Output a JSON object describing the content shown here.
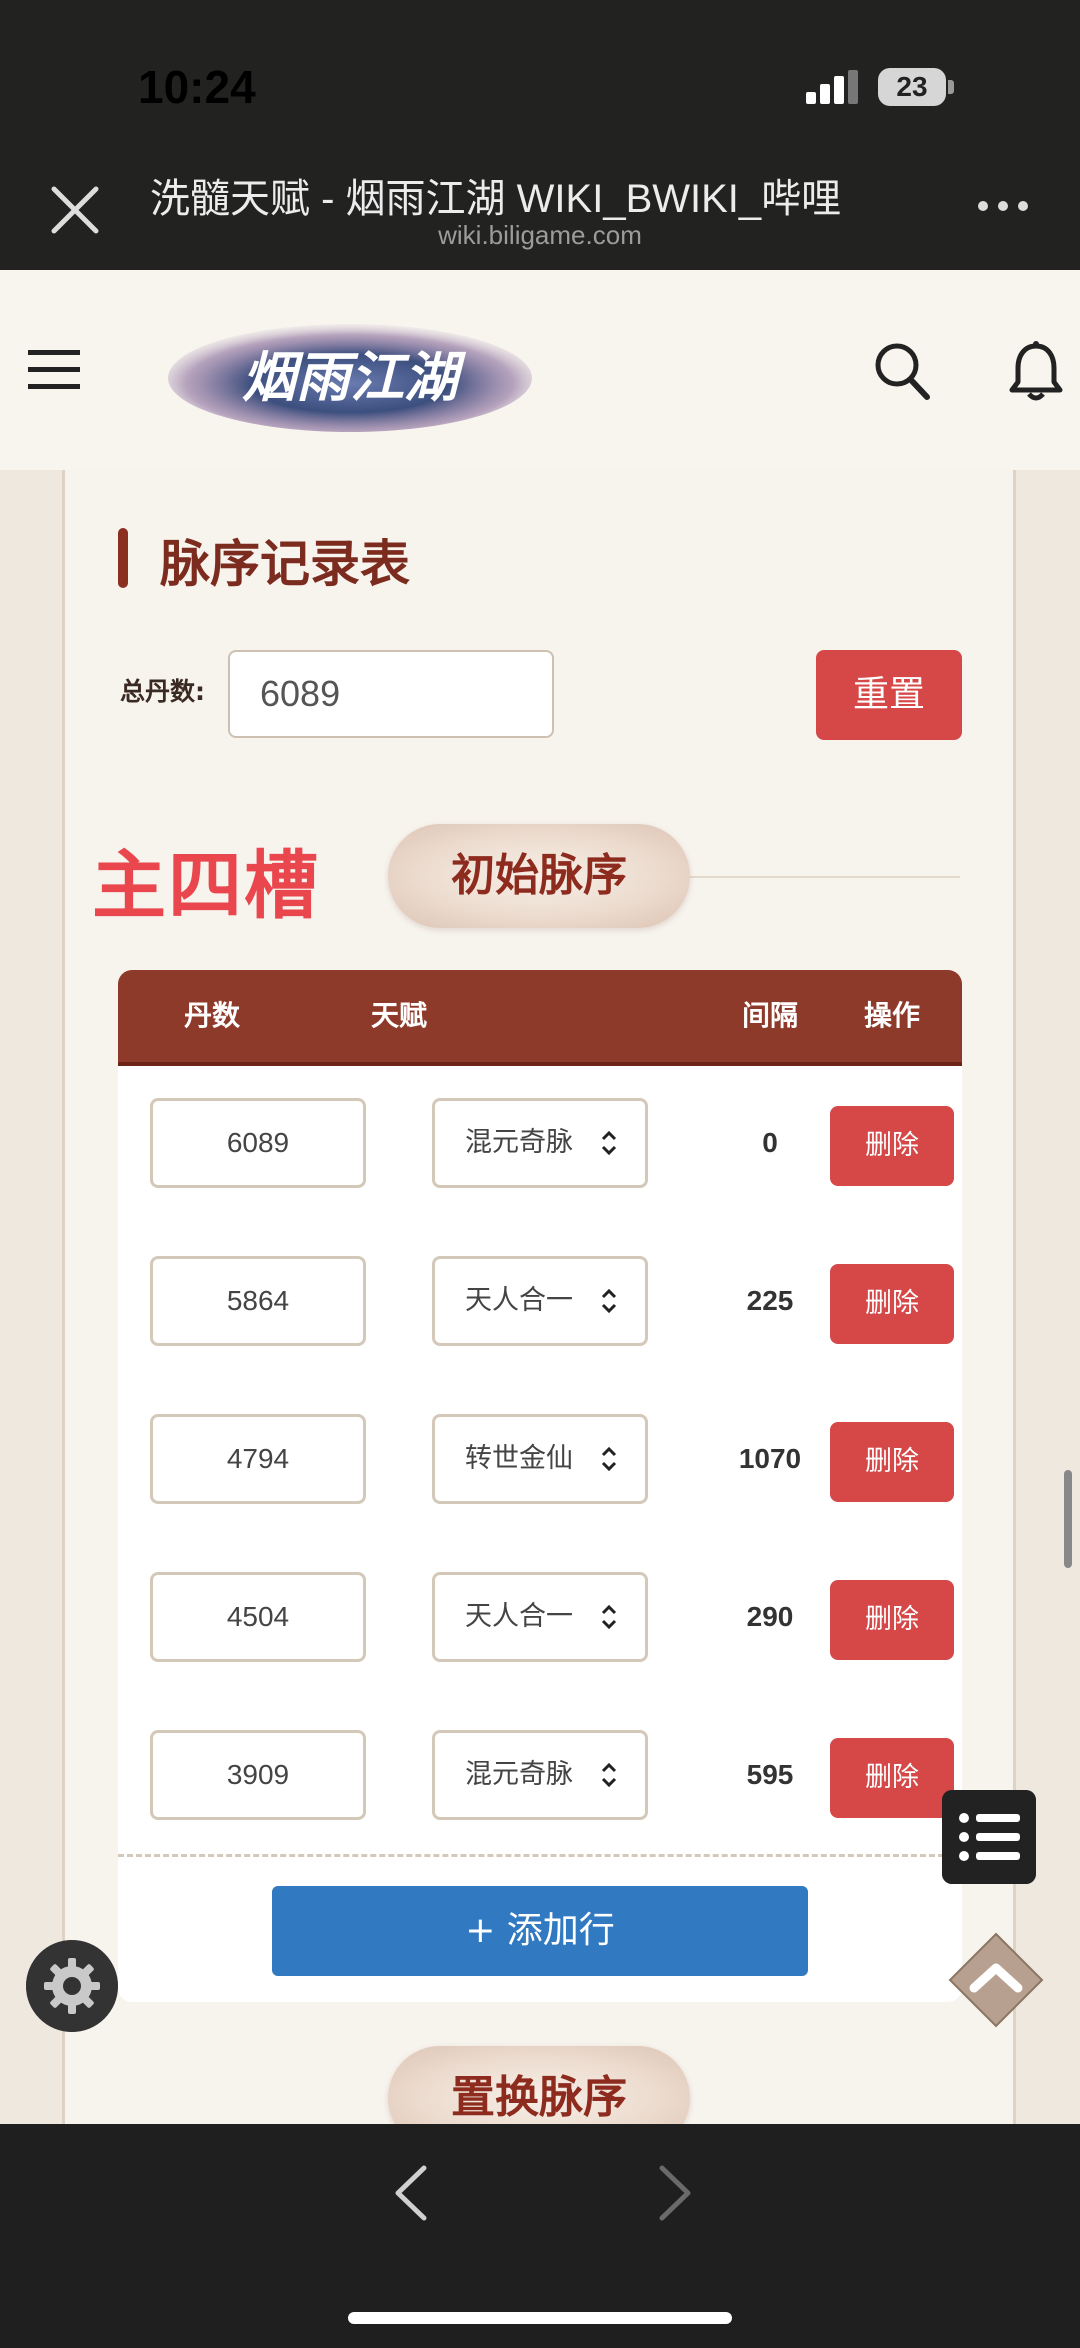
{
  "status_bar": {
    "time": "10:24",
    "battery": "23"
  },
  "browser": {
    "title": "洗髓天赋 - 烟雨江湖 WIKI_BWIKI_哔哩",
    "url": "wiki.biligame.com"
  },
  "site": {
    "logo_text": "烟雨江湖"
  },
  "section": {
    "title": "脉序记录表",
    "total_label": "总丹数:",
    "total_value": "6089",
    "reset_label": "重置"
  },
  "slot": {
    "title": "主四槽",
    "initial_label": "初始脉序",
    "swap_label": "置换脉序"
  },
  "table": {
    "headers": [
      "丹数",
      "天赋",
      "间隔",
      "操作"
    ],
    "rows": [
      {
        "dan": "6089",
        "talent": "混元奇脉",
        "gap": "0",
        "action": "删除"
      },
      {
        "dan": "5864",
        "talent": "天人合一",
        "gap": "225",
        "action": "删除"
      },
      {
        "dan": "4794",
        "talent": "转世金仙",
        "gap": "1070",
        "action": "删除"
      },
      {
        "dan": "4504",
        "talent": "天人合一",
        "gap": "290",
        "action": "删除"
      },
      {
        "dan": "3909",
        "talent": "混元奇脉",
        "gap": "595",
        "action": "删除"
      }
    ],
    "add_row_label": "+ 添加行"
  },
  "colors": {
    "accent_red": "#d64848",
    "header_brown": "#8e3a2a",
    "add_blue": "#3179c0",
    "slot_red": "#e9474d"
  },
  "icons": [
    "close-icon",
    "more-icon",
    "menu-icon",
    "search-icon",
    "bell-icon",
    "list-icon",
    "gear-icon",
    "chevron-up-icon",
    "back-icon",
    "forward-icon"
  ]
}
